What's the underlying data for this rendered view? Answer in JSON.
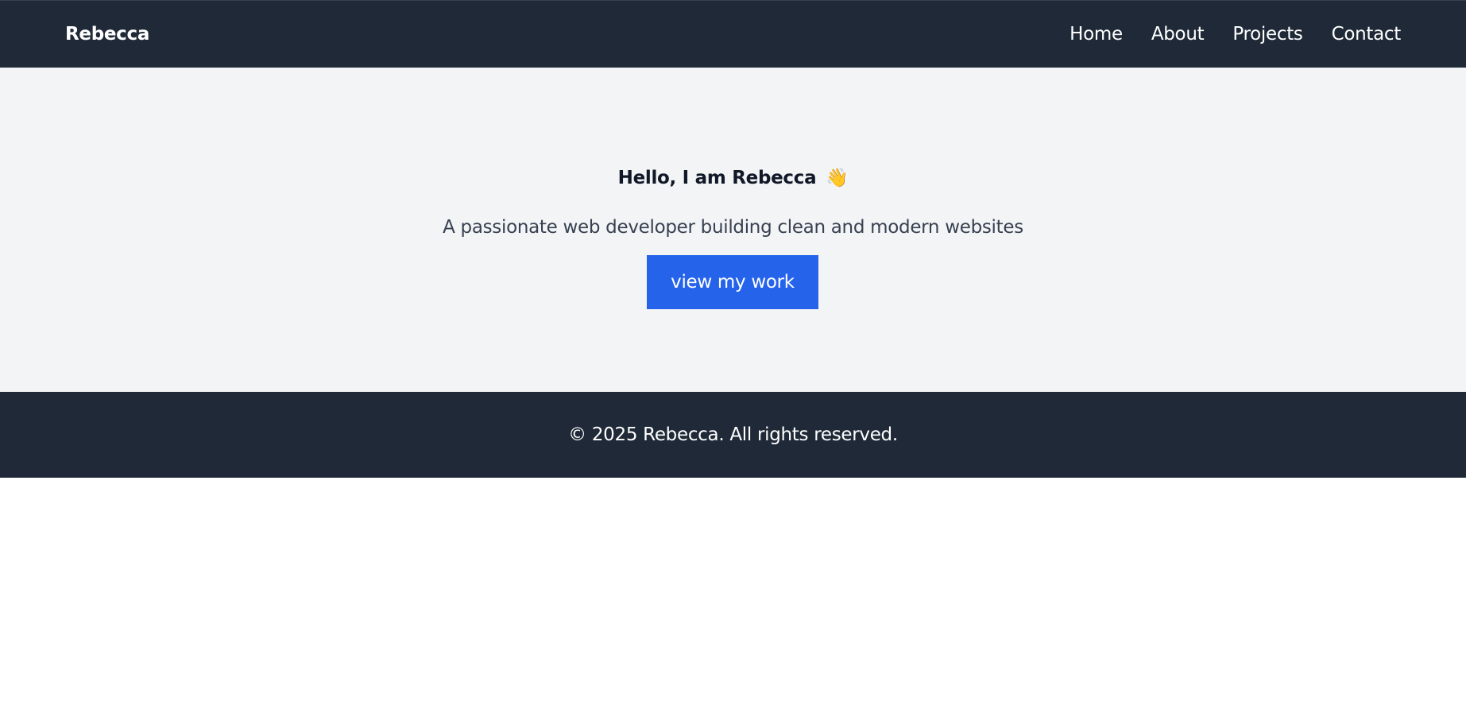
{
  "navbar": {
    "brand": "Rebecca",
    "links": [
      {
        "label": "Home"
      },
      {
        "label": "About"
      },
      {
        "label": "Projects"
      },
      {
        "label": "Contact"
      }
    ]
  },
  "hero": {
    "title": "Hello, I am Rebecca",
    "title_icon": "👋",
    "subtitle": "A passionate web developer building clean and modern websites",
    "button_label": "view my work"
  },
  "footer": {
    "text": "© 2025 Rebecca. All rights reserved."
  },
  "colors": {
    "nav_bg": "#1f2937",
    "hero_bg": "#f3f4f6",
    "accent": "#2563eb",
    "footer_bg": "#1f2937"
  },
  "icons": {
    "title_icon": "waving-hand-icon"
  }
}
